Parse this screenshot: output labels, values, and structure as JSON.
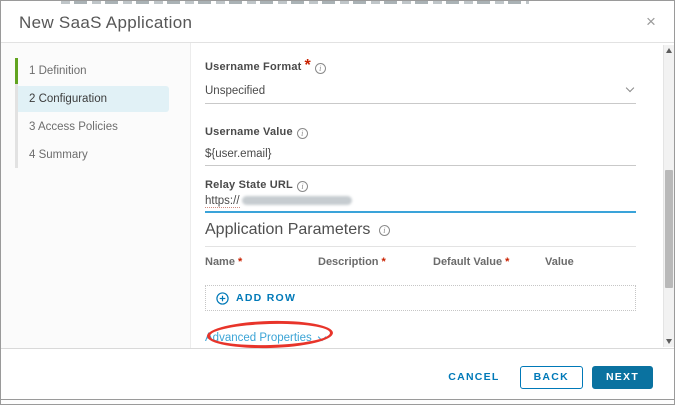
{
  "dialog": {
    "title": "New SaaS Application"
  },
  "icons": {
    "close": "×",
    "info": "i"
  },
  "wizard": {
    "steps": [
      {
        "label": "1 Definition",
        "state": "completed"
      },
      {
        "label": "2 Configuration",
        "state": "current"
      },
      {
        "label": "3 Access Policies",
        "state": "upcoming"
      },
      {
        "label": "4 Summary",
        "state": "upcoming"
      }
    ]
  },
  "form": {
    "required_marker": "*",
    "username_format": {
      "label": "Username Format",
      "required": true,
      "value": "Unspecified"
    },
    "username_value": {
      "label": "Username Value",
      "value": "${user.email}"
    },
    "relay_state_url": {
      "label": "Relay State URL",
      "value": "https://",
      "value_redacted": true,
      "focused": true
    }
  },
  "parameters": {
    "heading": "Application Parameters",
    "columns": [
      {
        "label": "Name",
        "required": true
      },
      {
        "label": "Description",
        "required": true
      },
      {
        "label": "Default Value",
        "required": true
      },
      {
        "label": "Value",
        "required": false
      }
    ],
    "add_row_label": "ADD ROW"
  },
  "advanced": {
    "label": "Advanced Properties",
    "annotated": true
  },
  "footer": {
    "cancel_label": "CANCEL",
    "back_label": "BACK",
    "next_label": "NEXT"
  },
  "colors": {
    "accent_blue": "#0079b8",
    "light_blue_link": "#3ba4d6",
    "primary_button_bg": "#0a72a0",
    "current_step_bg": "#e1f1f6",
    "completed_step_green": "#62a420",
    "required_red": "#c92100",
    "focus_underline": "#3aa3d9",
    "annotation_red": "#e8342a"
  }
}
